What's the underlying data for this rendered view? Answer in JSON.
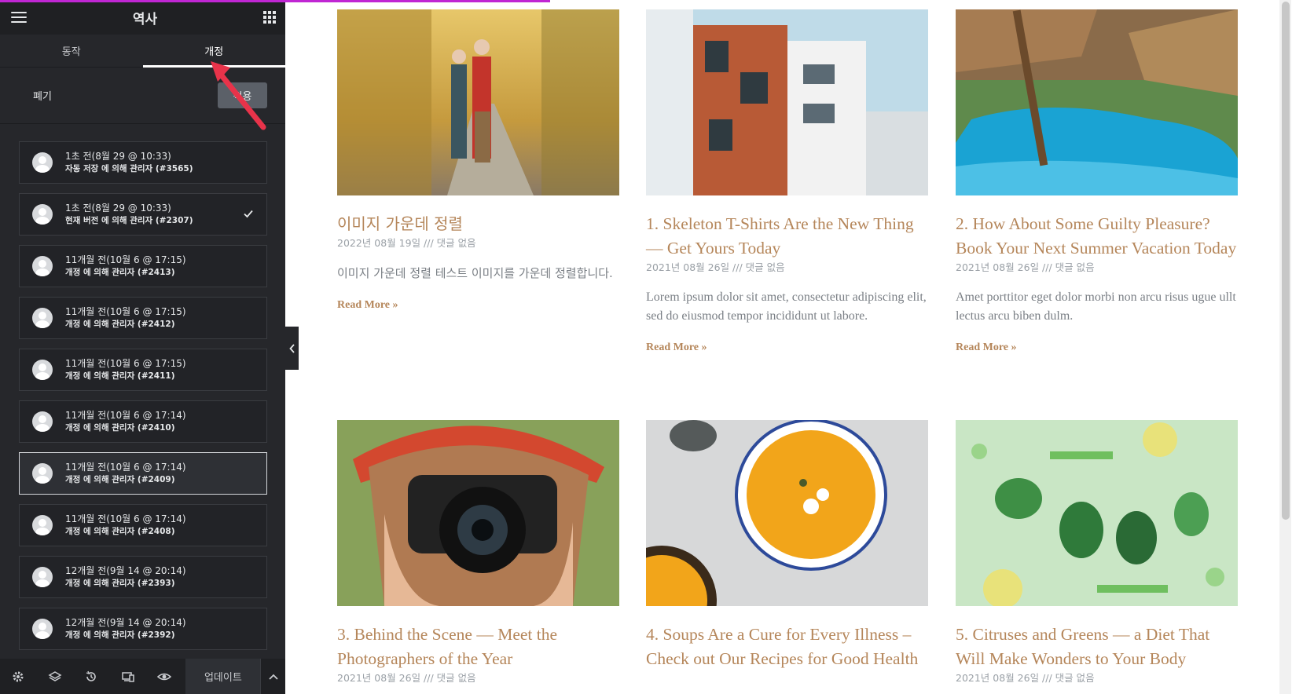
{
  "panel": {
    "title": "역사",
    "tabs": [
      {
        "label": "동작",
        "active": false
      },
      {
        "label": "개정",
        "active": true
      }
    ],
    "discard_label": "폐기",
    "apply_label": "적용",
    "revisions": [
      {
        "date": "1초 전(8월 29 @ 10:33)",
        "meta": "자동 저장 에 의해 관리자 (#3565)"
      },
      {
        "date": "1초 전(8월 29 @ 10:33)",
        "meta": "현재 버전 에 의해 관리자 (#2307)"
      },
      {
        "date": "11개월 전(10월 6 @ 17:15)",
        "meta": "개정 에 의해 관리자 (#2413)"
      },
      {
        "date": "11개월 전(10월 6 @ 17:15)",
        "meta": "개정 에 의해 관리자 (#2412)"
      },
      {
        "date": "11개월 전(10월 6 @ 17:15)",
        "meta": "개정 에 의해 관리자 (#2411)"
      },
      {
        "date": "11개월 전(10월 6 @ 17:14)",
        "meta": "개정 에 의해 관리자 (#2410)"
      },
      {
        "date": "11개월 전(10월 6 @ 17:14)",
        "meta": "개정 에 의해 관리자 (#2409)"
      },
      {
        "date": "11개월 전(10월 6 @ 17:14)",
        "meta": "개정 에 의해 관리자 (#2408)"
      },
      {
        "date": "12개월 전(9월 14 @ 20:14)",
        "meta": "개정 에 의해 관리자 (#2393)"
      },
      {
        "date": "12개월 전(9월 14 @ 20:14)",
        "meta": "개정 에 의해 관리자 (#2392)"
      }
    ],
    "footer": {
      "update_label": "업데이트",
      "icons": [
        "gear-icon",
        "layers-icon",
        "history-icon",
        "responsive-icon",
        "eye-icon"
      ]
    }
  },
  "posts": [
    {
      "title": "이미지 가운데 정렬",
      "meta": "2022년 08월 19일 /// 댓글 없음",
      "excerpt": "이미지 가운데 정렬 테스트 이미지를 가운데 정렬합니다.",
      "read_more": "Read More »",
      "image": "couple-autumn-path"
    },
    {
      "title": "1. Skeleton T-Shirts Are the New Thing — Get Yours Today",
      "meta": "2021년 08월 26일 /// 댓글 없음",
      "excerpt": "Lorem ipsum dolor sit amet, consectetur adipiscing elit, sed do eiusmod tempor incididunt ut labore.",
      "read_more": "Read More »",
      "image": "modern-building"
    },
    {
      "title": "2. How About Some Guilty Pleasure? Book Your Next Summer Vacation Today",
      "meta": "2021년 08월 26일 /// 댓글 없음",
      "excerpt": "Amet porttitor eget dolor morbi non arcu risus ugue ullt lectus arcu biben dulm.",
      "read_more": "Read More »",
      "image": "resort-pool"
    },
    {
      "title": "3. Behind the Scene — Meet the Photographers of the Year",
      "meta": "2021년 08월 26일 /// 댓글 없음",
      "image": "photographer-camera"
    },
    {
      "title": "4. Soups Are a Cure for Every Illness – Check out Our Recipes for Good Health",
      "meta": "",
      "image": "pumpkin-soup"
    },
    {
      "title": "5. Citruses and Greens — a Diet That Will Make Wonders to Your Body",
      "meta": "2021년 08월 26일 /// 댓글 없음",
      "image": "citrus-greens"
    }
  ],
  "colors": {
    "accent": "#b5865a",
    "panel_bg": "#26272b",
    "progress": "#c026d3"
  }
}
